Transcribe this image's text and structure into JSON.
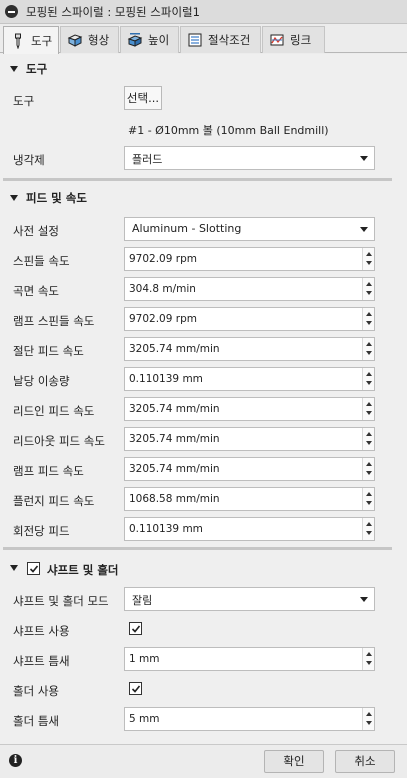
{
  "window": {
    "title": "모핑된 스파이럴 : 모핑된 스파이럴1"
  },
  "tabs": [
    {
      "label": "도구",
      "icon": "tool-icon"
    },
    {
      "label": "형상",
      "icon": "geometry-icon"
    },
    {
      "label": "높이",
      "icon": "heights-icon"
    },
    {
      "label": "절삭조건",
      "icon": "passes-icon"
    },
    {
      "label": "링크",
      "icon": "linking-icon"
    }
  ],
  "tool_section": {
    "title": "도구",
    "tool_label": "도구",
    "select_button": "선택...",
    "tool_description": "#1 - Ø10mm 볼 (10mm Ball Endmill)",
    "coolant_label": "냉각제",
    "coolant_value": "플러드"
  },
  "feed_section": {
    "title": "피드 및 속도",
    "preset_label": "사전 설정",
    "preset_value": "Aluminum - Slotting",
    "fields": [
      {
        "label": "스핀들 속도",
        "value": "9702.09 rpm"
      },
      {
        "label": "곡면 속도",
        "value": "304.8 m/min"
      },
      {
        "label": "램프 스핀들 속도",
        "value": "9702.09 rpm"
      },
      {
        "label": "절단 피드 속도",
        "value": "3205.74 mm/min"
      },
      {
        "label": "날당 이송량",
        "value": "0.110139 mm"
      },
      {
        "label": "리드인 피드 속도",
        "value": "3205.74 mm/min"
      },
      {
        "label": "리드아웃 피드 속도",
        "value": "3205.74 mm/min"
      },
      {
        "label": "램프 피드 속도",
        "value": "3205.74 mm/min"
      },
      {
        "label": "플런지 피드 속도",
        "value": "1068.58 mm/min"
      },
      {
        "label": "회전당 피드",
        "value": "0.110139 mm"
      }
    ]
  },
  "shaft_section": {
    "title": "샤프트 및 홀더",
    "enabled": true,
    "mode_label": "샤프트 및 홀더 모드",
    "mode_value": "잘림",
    "use_shaft_label": "샤프트 사용",
    "use_shaft": true,
    "shaft_clearance_label": "샤프트 틈새",
    "shaft_clearance_value": "1 mm",
    "use_holder_label": "홀더 사용",
    "use_holder": true,
    "holder_clearance_label": "홀더 틈새",
    "holder_clearance_value": "5 mm"
  },
  "footer": {
    "ok_label": "확인",
    "cancel_label": "취소"
  }
}
